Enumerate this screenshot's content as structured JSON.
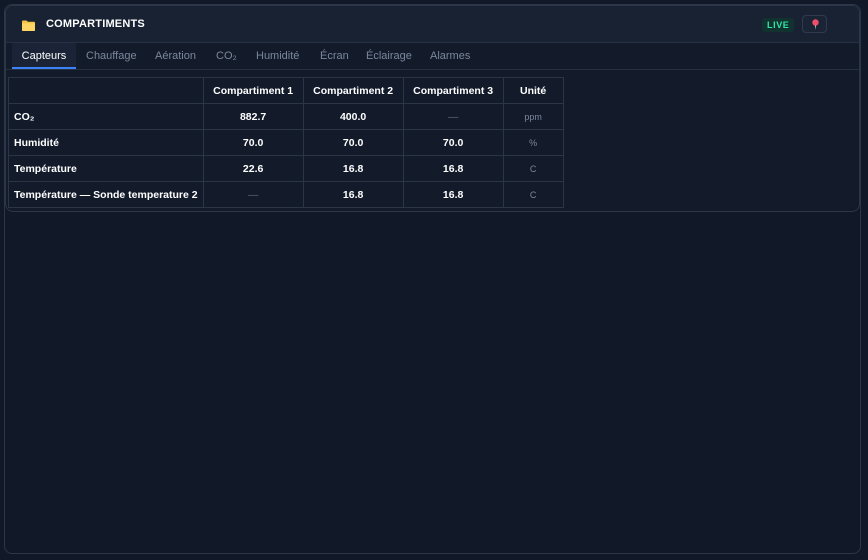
{
  "header": {
    "title": "COMPARTIMENTS",
    "live_label": "LIVE",
    "folder_icon": "folder-icon",
    "pin_icon": "pin-icon",
    "colors": {
      "accent": "#3b82f6",
      "live": "#2ee6a6",
      "folder": "#f5c542",
      "pin": "#ef4f6b"
    }
  },
  "tabs": [
    {
      "label": "Capteurs",
      "active": true
    },
    {
      "label": "Chauffage"
    },
    {
      "label": "Aération"
    },
    {
      "label": "CO₂"
    },
    {
      "label": "Humidité"
    },
    {
      "label": "Écran"
    },
    {
      "label": "Éclairage"
    },
    {
      "label": "Alarmes"
    }
  ],
  "table": {
    "columns": [
      "",
      "Compartiment 1",
      "Compartiment 2",
      "Compartiment 3",
      "Unité"
    ],
    "rows": [
      {
        "label": "CO₂",
        "values": [
          "882.7",
          "400.0",
          "—"
        ],
        "unit": "ppm"
      },
      {
        "label": "Humidité",
        "values": [
          "70.0",
          "70.0",
          "70.0"
        ],
        "unit": "%"
      },
      {
        "label": "Température",
        "values": [
          "22.6",
          "16.8",
          "16.8"
        ],
        "unit": "C"
      },
      {
        "label": "Température — Sonde temperature 2",
        "values": [
          "—",
          "16.8",
          "16.8"
        ],
        "unit": "C"
      }
    ]
  }
}
